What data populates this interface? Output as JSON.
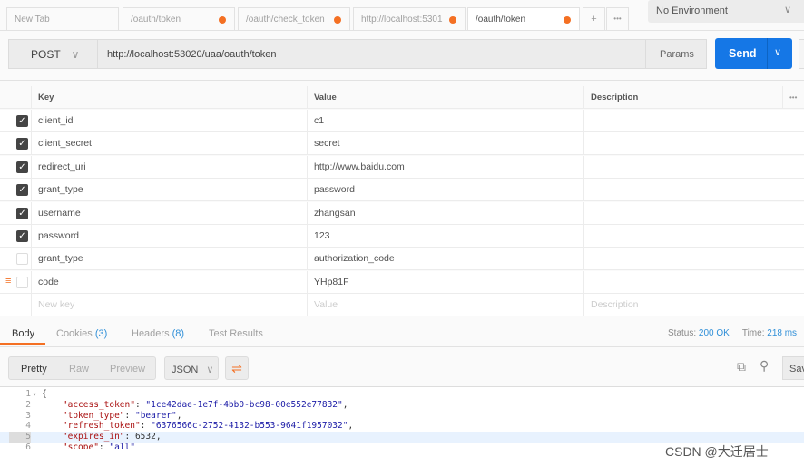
{
  "tabs": [
    {
      "label": "New Tab",
      "dirty": false
    },
    {
      "label": "/oauth/token",
      "dirty": true
    },
    {
      "label": "/oauth/check_token",
      "dirty": true
    },
    {
      "label": "http://localhost:5301",
      "dirty": true
    },
    {
      "label": "/oauth/token",
      "dirty": true,
      "active": true
    }
  ],
  "tab_add": "+",
  "tab_more": "•••",
  "environment": "No Environment",
  "request": {
    "method": "POST",
    "url": "http://localhost:53020/uaa/oauth/token",
    "params_label": "Params",
    "send_label": "Send"
  },
  "table": {
    "headers": [
      "Key",
      "Value",
      "Description"
    ],
    "rows": [
      {
        "checked": true,
        "key": "client_id",
        "value": "c1"
      },
      {
        "checked": true,
        "key": "client_secret",
        "value": "secret"
      },
      {
        "checked": true,
        "key": "redirect_uri",
        "value": "http://www.baidu.com"
      },
      {
        "checked": true,
        "key": "grant_type",
        "value": "password"
      },
      {
        "checked": true,
        "key": "username",
        "value": "zhangsan"
      },
      {
        "checked": true,
        "key": "password",
        "value": "123"
      },
      {
        "checked": false,
        "key": "grant_type",
        "value": "authorization_code"
      },
      {
        "checked": false,
        "key": "code",
        "value": "YHp81F"
      }
    ],
    "new_key_placeholder": "New key",
    "new_value_placeholder": "Value",
    "new_desc_placeholder": "Description"
  },
  "response": {
    "tabs": {
      "body": "Body",
      "cookies": "Cookies",
      "cookies_count": "(3)",
      "headers": "Headers",
      "headers_count": "(8)",
      "tests": "Test Results"
    },
    "status_label": "Status:",
    "status": "200 OK",
    "time_label": "Time:",
    "time": "218 ms",
    "views": [
      "Pretty",
      "Raw",
      "Preview"
    ],
    "format": "JSON",
    "save_label": "Sav",
    "lines": [
      {
        "n": "1",
        "parts": [
          [
            "n",
            "{"
          ]
        ]
      },
      {
        "n": "2",
        "parts": [
          [
            "k",
            "    \"access_token\""
          ],
          [
            "n",
            ": "
          ],
          [
            "s",
            "\"1ce42dae-1e7f-4bb0-bc98-00e552e77832\""
          ],
          [
            "n",
            ","
          ]
        ]
      },
      {
        "n": "3",
        "parts": [
          [
            "k",
            "    \"token_type\""
          ],
          [
            "n",
            ": "
          ],
          [
            "s",
            "\"bearer\""
          ],
          [
            "n",
            ","
          ]
        ]
      },
      {
        "n": "4",
        "parts": [
          [
            "k",
            "    \"refresh_token\""
          ],
          [
            "n",
            ": "
          ],
          [
            "s",
            "\"6376566c-2752-4132-b553-9641f1957032\""
          ],
          [
            "n",
            ","
          ]
        ]
      },
      {
        "n": "5",
        "parts": [
          [
            "k",
            "    \"expires_in\""
          ],
          [
            "n",
            ": 6532,"
          ]
        ]
      },
      {
        "n": "6",
        "parts": [
          [
            "k",
            "    \"scope\""
          ],
          [
            "n",
            ": "
          ],
          [
            "s",
            "\"all\""
          ]
        ]
      }
    ]
  },
  "watermark": "CSDN @大迁居士",
  "colors": {
    "accent": "#f47023",
    "send": "#1577e6",
    "link": "#2f8fd8"
  }
}
